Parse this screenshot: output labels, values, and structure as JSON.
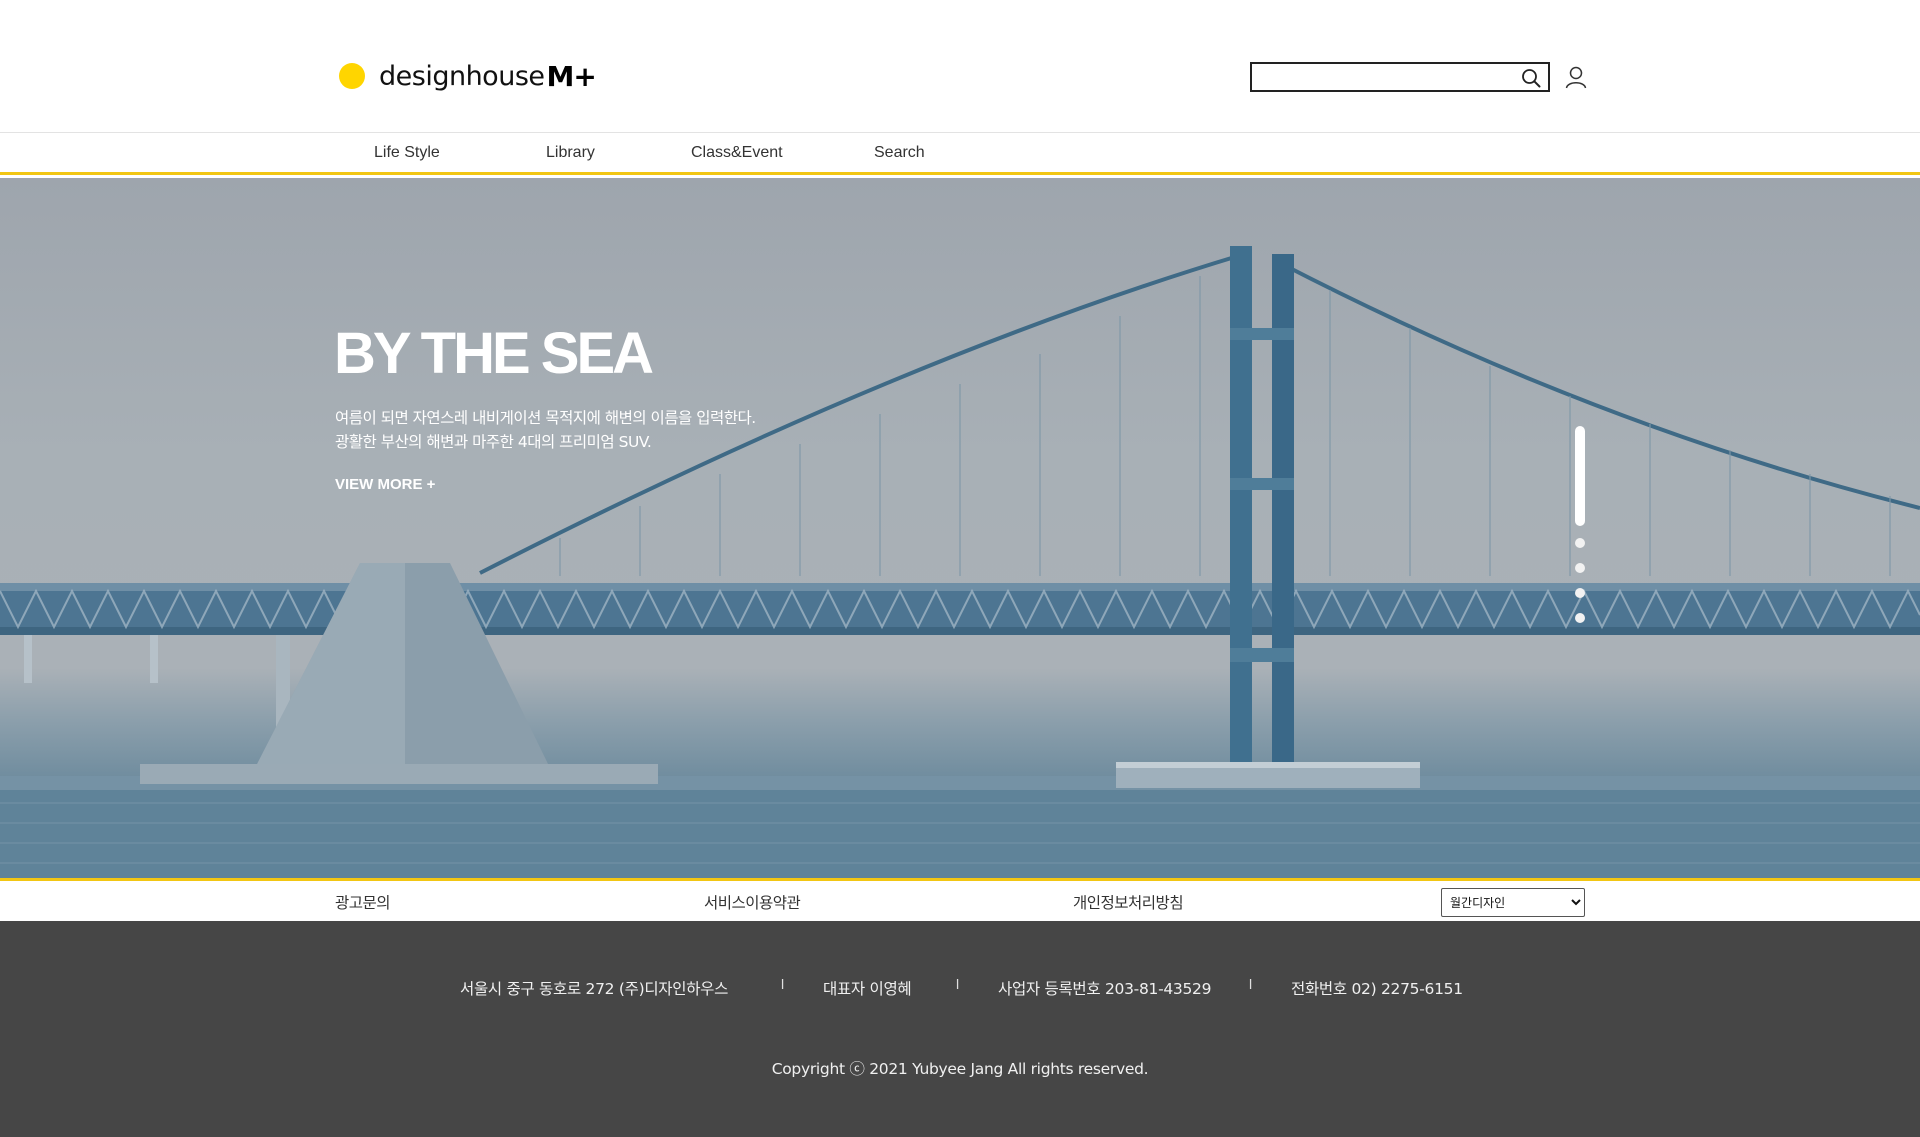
{
  "header": {
    "logo_text": "designhouse",
    "logo_mark": "M+",
    "search": {
      "value": "",
      "placeholder": ""
    },
    "icons": {
      "search": "search-icon",
      "user": "user-icon"
    }
  },
  "nav": {
    "items": [
      {
        "label": "Life Style"
      },
      {
        "label": "Library"
      },
      {
        "label": "Class&Event"
      },
      {
        "label": "Search"
      }
    ]
  },
  "hero": {
    "title": "BY THE SEA",
    "desc_line1": "여름이 되면 자연스레 내비게이션 목적지에 해변의 이름을 입력한다.",
    "desc_line2": "광활한 부산의 해변과 마주한 4대의 프리미엄 SUV.",
    "more": "VIEW MORE +",
    "pager": {
      "total": 4,
      "active": 1
    }
  },
  "footer_links": {
    "items": [
      {
        "label": "광고문의"
      },
      {
        "label": "서비스이용약관"
      },
      {
        "label": "개인정보처리방침"
      }
    ],
    "select": {
      "selected": "월간디자인",
      "options": [
        "월간디자인"
      ]
    }
  },
  "footer": {
    "address": "서울시 중구 동호로 272 (주)디자인하우스",
    "ceo": "대표자 이영혜",
    "business_no": "사업자 등록번호 203-81-43529",
    "phone": "전화번호 02) 2275-6151",
    "separator": "l",
    "copyright": "Copyright ⓒ 2021 Yubyee Jang All rights reserved."
  },
  "colors": {
    "accent": "#f2c613",
    "logo_dot": "#ffd500",
    "footer_bg": "#464646"
  }
}
